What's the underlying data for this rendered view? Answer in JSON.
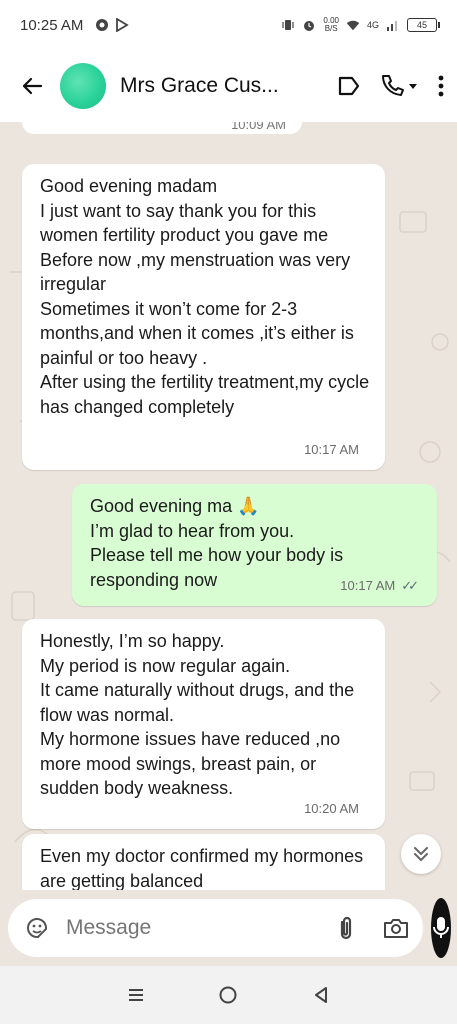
{
  "status_bar": {
    "time": "10:25 AM",
    "net_speed_top": "0.00",
    "net_speed_bottom": "B/S",
    "network": "4G",
    "battery": "45"
  },
  "header": {
    "contact_name": "Mrs Grace Cus..."
  },
  "chat": {
    "previous_time": "10:09 AM",
    "messages": [
      {
        "direction": "in",
        "text": "Good evening madam\nI just want to say thank you for this women fertility product you gave me\nBefore now ,my menstruation was very irregular\nSometimes it won’t come for 2-3 months,and when it comes ,it’s either is painful or too heavy .\nAfter using the fertility treatment,my cycle has changed completely",
        "time": "10:17 AM"
      },
      {
        "direction": "out",
        "text": "Good evening ma 🙏\nI’m glad to hear from you.\nPlease tell me how your body is responding now",
        "time": "10:17 AM",
        "read_ticks": "✓✓"
      },
      {
        "direction": "in",
        "text": "Honestly, I’m so happy.\nMy period is now regular again.\nIt came naturally without drugs, and the flow was normal.\nMy hormone issues have reduced ,no more mood swings, breast pain, or sudden body weakness.",
        "time": "10:20 AM"
      },
      {
        "direction": "in",
        "text": "Even my doctor confirmed my hormones are getting balanced",
        "time": ""
      }
    ]
  },
  "input": {
    "placeholder": "Message"
  },
  "colors": {
    "incoming_bubble": "#ffffff",
    "outgoing_bubble": "#d9fdd3",
    "chat_background": "#ece5dd",
    "read_ticks": "#5b6b73",
    "mic_button": "#111111"
  }
}
